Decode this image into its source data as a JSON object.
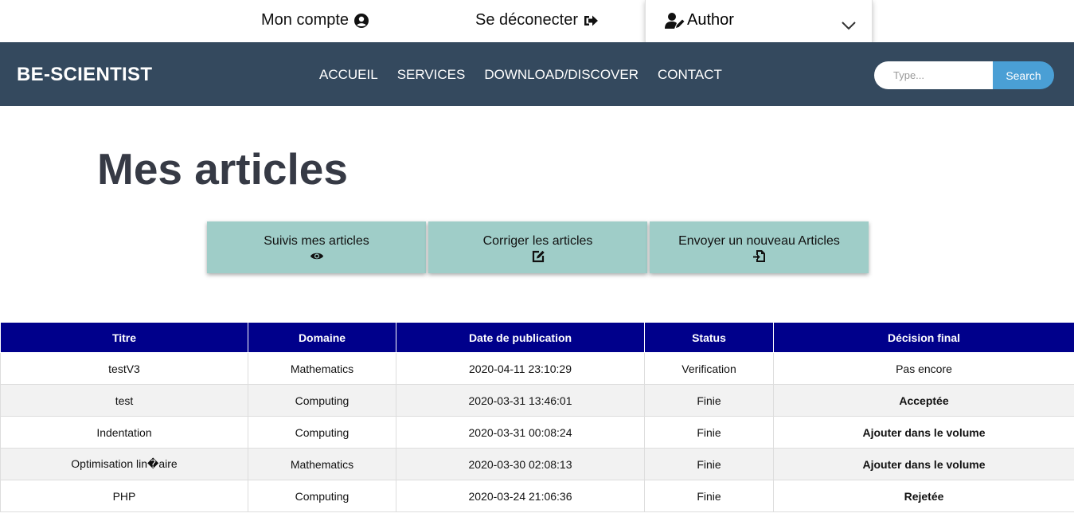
{
  "topbar": {
    "account_label": "Mon compte",
    "logout_label": "Se déconecter",
    "role_label": "Author"
  },
  "nav": {
    "brand": "BE-SCIENTIST",
    "links": [
      "ACCUEIL",
      "SERVICES",
      "DOWNLOAD/DISCOVER",
      "CONTACT"
    ],
    "search_placeholder": "Type...",
    "search_button": "Search"
  },
  "page": {
    "title": "Mes articles"
  },
  "actions": [
    {
      "label": "Suivis mes articles",
      "icon": "eye-icon"
    },
    {
      "label": "Corriger les articles",
      "icon": "edit-icon"
    },
    {
      "label": "Envoyer un nouveau Articles",
      "icon": "file-import-icon"
    }
  ],
  "table": {
    "headers": [
      "Titre",
      "Domaine",
      "Date de publication",
      "Status",
      "Décision final"
    ],
    "rows": [
      {
        "titre": "testV3",
        "domaine": "Mathematics",
        "date": "2020-04-11 23:10:29",
        "status": "Verification",
        "decision": "Pas encore"
      },
      {
        "titre": "test",
        "domaine": "Computing",
        "date": "2020-03-31 13:46:01",
        "status": "Finie",
        "decision": "Acceptée"
      },
      {
        "titre": "Indentation",
        "domaine": "Computing",
        "date": "2020-03-31 00:08:24",
        "status": "Finie",
        "decision": "Ajouter dans le volume"
      },
      {
        "titre": "Optimisation lin�aire",
        "domaine": "Mathematics",
        "date": "2020-03-30 02:08:13",
        "status": "Finie",
        "decision": "Ajouter dans le volume"
      },
      {
        "titre": "PHP",
        "domaine": "Computing",
        "date": "2020-03-24 21:06:36",
        "status": "Finie",
        "decision": "Rejetée"
      }
    ]
  },
  "colors": {
    "navbar": "#34495e",
    "table_header": "#00008b",
    "action_button": "#9fcdc8",
    "status_done": "#228b22",
    "decision_accept": "#0a8a0a",
    "decision_reject": "#e00000"
  }
}
